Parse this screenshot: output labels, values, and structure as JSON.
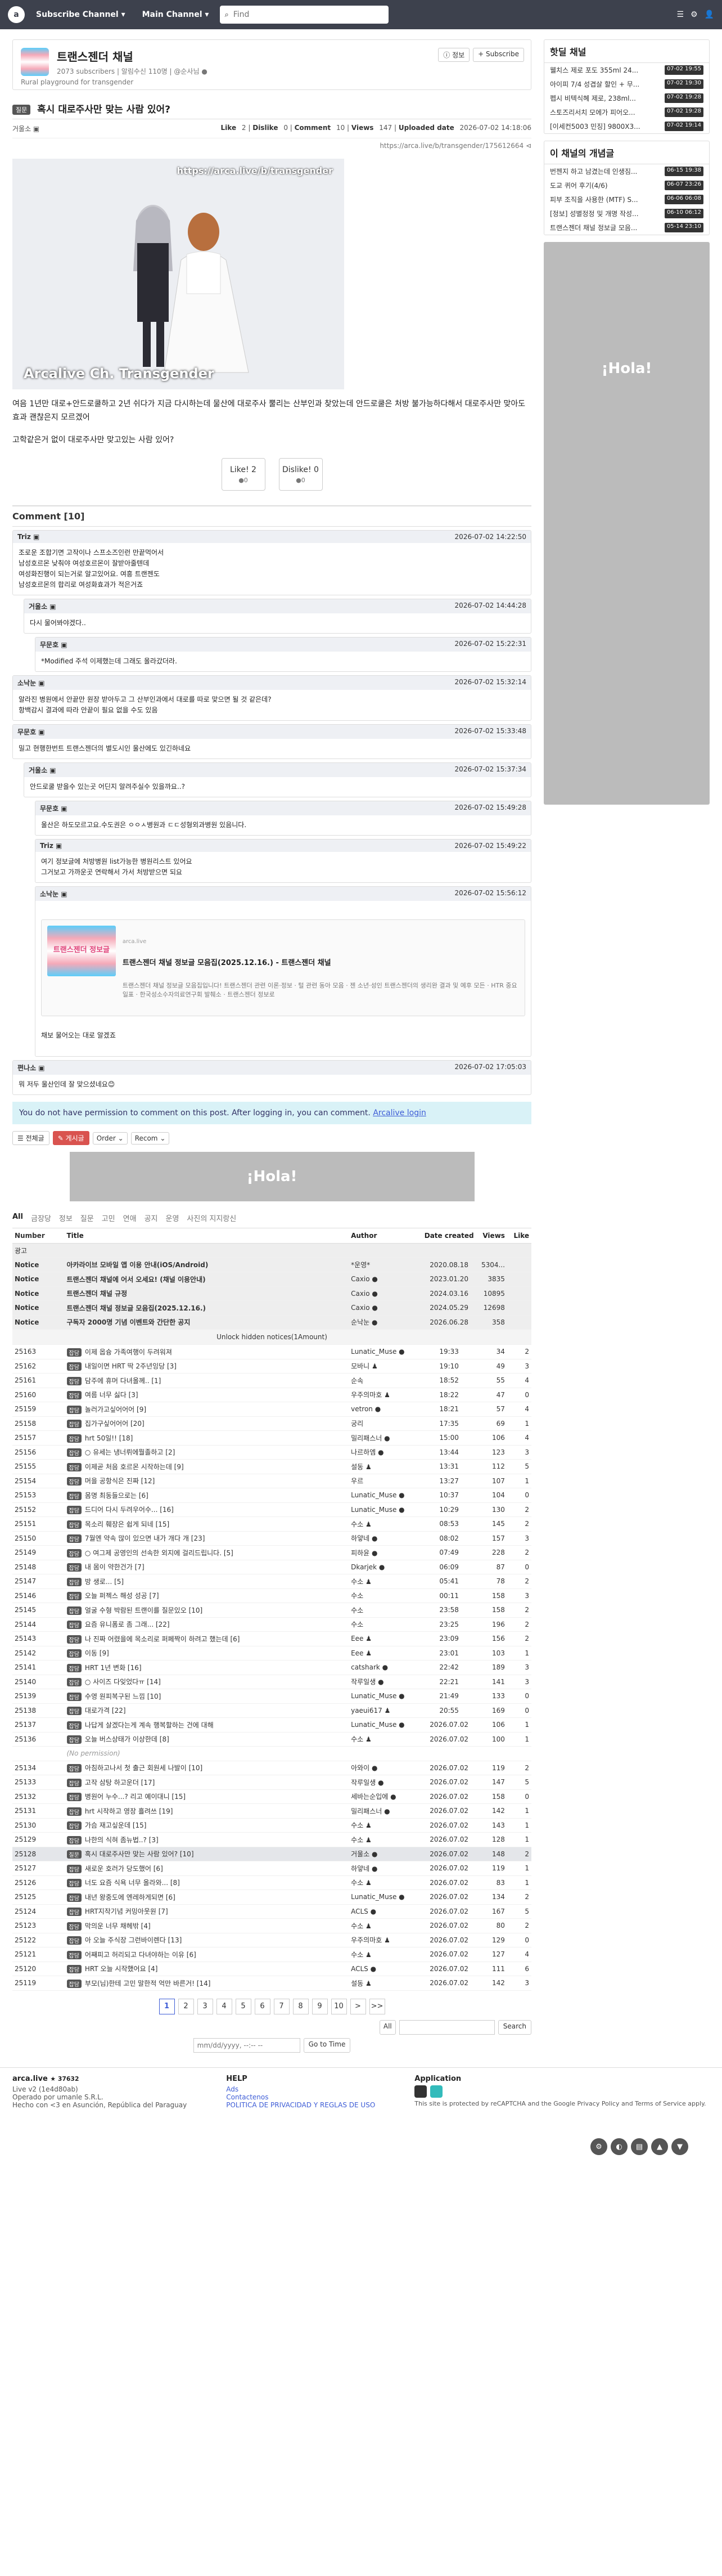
{
  "topbar": {
    "logo": "a",
    "subscribe_channel": "Subscribe Channel ▾",
    "main_channel": "Main Channel ▾",
    "search_placeholder": "Find",
    "right_items": [
      "☰",
      "⚙",
      "👤"
    ]
  },
  "board": {
    "title": "트랜스젠더 채널",
    "meta": "2073 subscribers | 알림수신 110명 | @순사님 ●",
    "desc": "Rural playground for transgender",
    "info_btn": "ⓘ 정보",
    "subscribe_btn": "+ Subscribe"
  },
  "article": {
    "category": "질문",
    "title": "혹시 대로주사만 맞는 사람 있어?",
    "author": "거울소 ▣",
    "like_label": "Like",
    "like": "2",
    "dislike_label": "Dislike",
    "dislike": "0",
    "comment_label": "Comment",
    "comment": "10",
    "views_label": "Views",
    "views": "147",
    "uploaded_label": "Uploaded date",
    "uploaded": "2026-07-02 14:18:06",
    "link": "https://arca.live/b/transgender/175612664 ⊲",
    "image_url_text": "https://arca.live/b/transgender",
    "image_watermark": "Arcalive Ch. Transgender",
    "body": [
      "여음 1년만 대로+안드로쿨하고 2년 쉬다가 지금 다시하는데 물산에 대로주사 뿔리는 산부인과 찾았는데 안드로쿨은 처방 불가능하다해서 대로주사만 맞아도 효과 괜찮은지 모르겠어",
      "고학같은거 없이 대로주사만 맞고있는 사람 있어?"
    ],
    "like_btn": "Like!",
    "like_btn_count": "2",
    "like_btn_sub": "●0",
    "dislike_btn": "Dislike!",
    "dislike_btn_count": "0",
    "dislike_btn_sub": "●0"
  },
  "comments_title": "Comment [10]",
  "comments": [
    {
      "who": "Triz ▣",
      "date": "2026-07-02 14:22:50",
      "text": "조로운 조합기면 고작이나 스프소즈인런 만끝먹어서\n남성호르몬 낮춰야 여성호르몬이 잘받아줄텐데\n여성화진행이 되는거로 알고있어요. 여흥 트랜젠도\n남성호르몬의 합리로 여성화효과가 적은거죠"
    },
    {
      "who": "거울소 ▣",
      "date": "2026-07-02 14:44:28",
      "text": "다시 물어봐야겠다.."
    },
    {
      "who": "무문호 ▣",
      "date": "2026-07-02 15:22:31",
      "text": "*Modified 주석 이제했는데 그래도 올라갔더라."
    },
    {
      "who": "소낙눈 ▣",
      "date": "2026-07-02 15:32:14",
      "text": "알라진 병원에서 안끝만 원장 받아두고 그 산부인과에서 대로를 따로 맞으면 될 것 같은데?\n항백감시 결과에 따라 안끝이 필요 없을 수도 있음"
    },
    {
      "who": "무문호 ▣",
      "date": "2026-07-02 15:33:48",
      "text": "밀고 현행한번트 트랜스젠더의 별도시인 울산에도 있긴하네요"
    },
    {
      "who": "거울소 ▣",
      "date": "2026-07-02 15:37:34",
      "text": "안드로쿨 받을수 있는곳 어딘지 알려주실수 있을까요..?"
    },
    {
      "who": "무문호 ▣",
      "date": "2026-07-02 15:49:28",
      "text": "울산은 하도모르고요.수도권은 ㅇㅇㅅ병원과 ㄷㄷ성형외과병원 있음니다."
    },
    {
      "who": "Triz ▣",
      "date": "2026-07-02 15:49:22",
      "text": "여기 정보글에 처방병원 list가능한 병원리스트 있어요\n그거보고 가까운곳 연락해서 가서 처방받으면 되요"
    },
    {
      "who": "소낙눈 ▣",
      "date": "2026-07-02 15:56:12",
      "text": ""
    },
    {
      "who": "편나소 ▣",
      "date": "2026-07-02 17:05:03",
      "text": "뭐 저두 울산인데 잘 맞으셨네요😊"
    }
  ],
  "embed": {
    "img_text": "트랜스젠더 정보글",
    "site": "arca.live",
    "title": "트랜스젠더 채널 정보글 모음집(2025.12.16.) - 트랜스젠더 채널",
    "desc": "트랜스젠더 채널 정보글 모음집입니다! 트랜스젠더 관련 이론·정보 · 털 관련 동아 모음 · 젠 소년·성인 트랜스젠더의 생리완 결과 및 예후 모든 · HTR 중요일표 · 한국성소수자의료연구회 발췌소 · 트랜스젠더 정보로",
    "after": "채보 물어오는 대로 알겠죠"
  },
  "notice": {
    "text": "You do not have permission to comment on this post. After logging in, you can comment.",
    "login": "Arcalive login"
  },
  "tools": {
    "view_all": "☰ 전체글",
    "write": "✎ 게시글",
    "order": "Order ⌄",
    "recom": "Recom ⌄"
  },
  "ad_text": "¡Hola!",
  "cats": [
    "All",
    "금장당",
    "정보",
    "질문",
    "고민",
    "연애",
    "공지",
    "운영",
    "사진의 지지랑신"
  ],
  "table": {
    "headers": {
      "num": "Number",
      "title": "Title",
      "author": "Author",
      "date": "Date created",
      "views": "Views",
      "like": "Like"
    },
    "ad_row": "광고",
    "notices": [
      {
        "num": "Notice",
        "title": "아카라이브 모바일 앱 이용 안내(iOS/Android)",
        "author": "*운영*",
        "date": "2020.08.18",
        "views": "5304...",
        "like": ""
      },
      {
        "num": "Notice",
        "title": "트랜스젠더 채널에 어서 오세요! (채널 이용안내)",
        "author": "Caxio ●",
        "date": "2023.01.20",
        "views": "3835",
        "like": ""
      },
      {
        "num": "Notice",
        "title": "트랜스젠더 채널 규정",
        "author": "Caxio ●",
        "date": "2024.03.16",
        "views": "10895",
        "like": ""
      },
      {
        "num": "Notice",
        "title": "트랜스젠더 채널 정보글 모음집(2025.12.16.)",
        "author": "Caxio ●",
        "date": "2024.05.29",
        "views": "12698",
        "like": ""
      },
      {
        "num": "Notice",
        "title": "구독자 2000명 기념 이벤트와 간단한 공지",
        "author": "순낙눈 ●",
        "date": "2026.06.28",
        "views": "358",
        "like": ""
      }
    ],
    "unlock": "Unlock hidden notices(1Amount)",
    "rows": [
      {
        "num": "25163",
        "cat": "잡담",
        "title": "이제 옵슝 가족여행이 두려워져",
        "author": "Lunatic_Muse ●",
        "date": "19:33",
        "views": "34",
        "like": "2"
      },
      {
        "num": "25162",
        "cat": "잡담",
        "title": "내일이면 HRT 딱 2주년잉당 [3]",
        "author": "모바니 ♟",
        "date": "19:10",
        "views": "49",
        "like": "3"
      },
      {
        "num": "25161",
        "cat": "잡담",
        "title": "담주에 휴머 다녀올께.. [1]",
        "author": "순속",
        "date": "18:52",
        "views": "55",
        "like": "4"
      },
      {
        "num": "25160",
        "cat": "잡담",
        "title": "여름 너무 싫다 [3]",
        "author": "우주의마호 ♟",
        "date": "18:22",
        "views": "47",
        "like": "0"
      },
      {
        "num": "25159",
        "cat": "잡담",
        "title": "놀러가고싶어어어 [9]",
        "author": "vetron ●",
        "date": "18:21",
        "views": "57",
        "like": "4"
      },
      {
        "num": "25158",
        "cat": "잡담",
        "title": "집가구싶어어어 [20]",
        "author": "궁리",
        "date": "17:35",
        "views": "69",
        "like": "1"
      },
      {
        "num": "25157",
        "cat": "잡담",
        "title": "hrt 50일!! [18]",
        "author": "밀리패스너 ●",
        "date": "15:00",
        "views": "106",
        "like": "4"
      },
      {
        "num": "25156",
        "cat": "잡담",
        "title": "○ 유세는 냉너뤼에뭘졸하고 [2]",
        "author": "나르하엠 ●",
        "date": "13:44",
        "views": "123",
        "like": "3"
      },
      {
        "num": "25155",
        "cat": "잡담",
        "title": "이제곧 처음 호르몬 시작하는데 [9]",
        "author": "설동 ♟",
        "date": "13:31",
        "views": "112",
        "like": "5"
      },
      {
        "num": "25154",
        "cat": "잡담",
        "title": "머을 공항식은 진짜 [12]",
        "author": "우르",
        "date": "13:27",
        "views": "107",
        "like": "1"
      },
      {
        "num": "25153",
        "cat": "잡담",
        "title": "몸명 최동들으로는 [6]",
        "author": "Lunatic_Muse ●",
        "date": "10:37",
        "views": "104",
        "like": "0"
      },
      {
        "num": "25152",
        "cat": "잡담",
        "title": "드디어 다시 두려우어수... [16]",
        "author": "Lunatic_Muse ●",
        "date": "10:29",
        "views": "130",
        "like": "2"
      },
      {
        "num": "25151",
        "cat": "잡담",
        "title": "목소리 훼장은 쉽게 되네 [15]",
        "author": "수소 ♟",
        "date": "08:53",
        "views": "145",
        "like": "2"
      },
      {
        "num": "25150",
        "cat": "잡담",
        "title": "7월엔 약속 많이 있으면 내가 개다 개 [23]",
        "author": "하얗네 ●",
        "date": "08:02",
        "views": "157",
        "like": "3"
      },
      {
        "num": "25149",
        "cat": "잡담",
        "title": "○ 여그제 공영인의 선속한 외지에 걸리드립니다. [5]",
        "author": "피하윤 ●",
        "date": "07:49",
        "views": "228",
        "like": "2"
      },
      {
        "num": "25148",
        "cat": "잡담",
        "title": "내 몸이 약한건가 [7]",
        "author": "Dkarjek ●",
        "date": "06:09",
        "views": "87",
        "like": "0"
      },
      {
        "num": "25147",
        "cat": "잡담",
        "title": "방 생로... [5]",
        "author": "수소 ♟",
        "date": "05:41",
        "views": "78",
        "like": "2"
      },
      {
        "num": "25146",
        "cat": "잡담",
        "title": "오늘 퍼젝스 해성 성공 [7]",
        "author": "수소",
        "date": "00:11",
        "views": "158",
        "like": "3"
      },
      {
        "num": "25145",
        "cat": "잡담",
        "title": "얼굴 수형 박람된 트랜이를 질문있오 [10]",
        "author": "수소",
        "date": "23:58",
        "views": "158",
        "like": "2"
      },
      {
        "num": "25144",
        "cat": "잡담",
        "title": "요즘 유니폼로 좀 그래... [22]",
        "author": "수소",
        "date": "23:25",
        "views": "196",
        "like": "2"
      },
      {
        "num": "25143",
        "cat": "잡담",
        "title": "나 진짜 어렸을에 목소리로 퍼페짝이 하려고 했는데 [6]",
        "author": "Eee ♟",
        "date": "23:09",
        "views": "156",
        "like": "2"
      },
      {
        "num": "25142",
        "cat": "잡담",
        "title": "이동 [9]",
        "author": "Eee ♟",
        "date": "23:01",
        "views": "103",
        "like": "1"
      },
      {
        "num": "25141",
        "cat": "잡담",
        "title": "HRT 1년 변화 [16]",
        "author": "catshark ●",
        "date": "22:42",
        "views": "189",
        "like": "3"
      },
      {
        "num": "25140",
        "cat": "잡담",
        "title": "○ 사이즈 다잊었다ㅠ [14]",
        "author": "작루일생 ●",
        "date": "22:21",
        "views": "141",
        "like": "3"
      },
      {
        "num": "25139",
        "cat": "잡담",
        "title": "수영 원피복구된 느낌 [10]",
        "author": "Lunatic_Muse ●",
        "date": "21:49",
        "views": "133",
        "like": "0"
      },
      {
        "num": "25138",
        "cat": "잡담",
        "title": "대로가격 [22]",
        "author": "yaeui617 ♟",
        "date": "20:55",
        "views": "169",
        "like": "0"
      },
      {
        "num": "25137",
        "cat": "잡담",
        "title": "나답게 살겠다는게 계속 행복할하는 건에 대해",
        "author": "Lunatic_Muse ●",
        "date": "2026.07.02",
        "views": "106",
        "like": "1"
      },
      {
        "num": "25136",
        "cat": "잡담",
        "title": "오늘 버스상태가 이상한데 [8]",
        "author": "수소 ♟",
        "date": "2026.07.02",
        "views": "100",
        "like": "1"
      },
      {
        "num": "",
        "cat": "",
        "title": "(No permission)",
        "author": "",
        "date": "",
        "views": "",
        "like": ""
      },
      {
        "num": "25134",
        "cat": "잡담",
        "title": "아침하고나서 첫 출근 회원세 나발이 [10]",
        "author": "아와이 ●",
        "date": "2026.07.02",
        "views": "119",
        "like": "2"
      },
      {
        "num": "25133",
        "cat": "잡담",
        "title": "고작 삼탕 하고운더 [17]",
        "author": "작루일생 ●",
        "date": "2026.07.02",
        "views": "147",
        "like": "5"
      },
      {
        "num": "25132",
        "cat": "잡담",
        "title": "병원어 누수...? 리고 예이대니 [15]",
        "author": "세바는순입에 ●",
        "date": "2026.07.02",
        "views": "158",
        "like": "0"
      },
      {
        "num": "25131",
        "cat": "잡담",
        "title": "hrt 시작하고 영장 흘려쓰 [19]",
        "author": "밀리패스너 ●",
        "date": "2026.07.02",
        "views": "142",
        "like": "1"
      },
      {
        "num": "25130",
        "cat": "잡담",
        "title": "가슴 재고싶운데 [15]",
        "author": "수소 ♟",
        "date": "2026.07.02",
        "views": "143",
        "like": "1"
      },
      {
        "num": "25129",
        "cat": "잡담",
        "title": "나한의 식혀 좀뉴법..? [3]",
        "author": "수소 ♟",
        "date": "2026.07.02",
        "views": "128",
        "like": "1"
      },
      {
        "num": "25128",
        "cat": "질문",
        "title": "혹시 대로주사만 맞는 사람 있어? [10]",
        "author": "거울소 ●",
        "date": "2026.07.02",
        "views": "148",
        "like": "2",
        "current": true
      },
      {
        "num": "25127",
        "cat": "잡담",
        "title": "새로운 호러가 당도했어 [6]",
        "author": "하얗네 ●",
        "date": "2026.07.02",
        "views": "119",
        "like": "1"
      },
      {
        "num": "25126",
        "cat": "잡담",
        "title": "너도 요즘 식욕 너무 올라와... [8]",
        "author": "수소 ♟",
        "date": "2026.07.02",
        "views": "83",
        "like": "1"
      },
      {
        "num": "25125",
        "cat": "잡담",
        "title": "내년 왕중도에 엔레하게되면 [6]",
        "author": "Lunatic_Muse ●",
        "date": "2026.07.02",
        "views": "134",
        "like": "2"
      },
      {
        "num": "25124",
        "cat": "잡담",
        "title": "HRT지작기념 커밍아웃원 [7]",
        "author": "ACLS ●",
        "date": "2026.07.02",
        "views": "167",
        "like": "5"
      },
      {
        "num": "25123",
        "cat": "잡담",
        "title": "막의운 너무 채헤밖 [4]",
        "author": "수소 ♟",
        "date": "2026.07.02",
        "views": "80",
        "like": "2"
      },
      {
        "num": "25122",
        "cat": "잡담",
        "title": "아 오늘 주식장 그런바이렌다 [13]",
        "author": "우주의마호 ♟",
        "date": "2026.07.02",
        "views": "129",
        "like": "0"
      },
      {
        "num": "25121",
        "cat": "잡담",
        "title": "어째피고 허리되고 다녀야하는 이유 [6]",
        "author": "수소 ♟",
        "date": "2026.07.02",
        "views": "127",
        "like": "4"
      },
      {
        "num": "25120",
        "cat": "잡담",
        "title": "HRT 오늘 시작했어요 [4]",
        "author": "ACLS ●",
        "date": "2026.07.02",
        "views": "111",
        "like": "6"
      },
      {
        "num": "25119",
        "cat": "잡담",
        "title": "부모(님)한테 고민 말한적 억만 바른거! [14]",
        "author": "설동 ♟",
        "date": "2026.07.02",
        "views": "142",
        "like": "3"
      }
    ]
  },
  "pager": [
    "1",
    "2",
    "3",
    "4",
    "5",
    "6",
    "7",
    "8",
    "9",
    "10",
    ">",
    ">>"
  ],
  "bottom_search": {
    "select": "All",
    "button": "Search"
  },
  "date_goto": {
    "placeholder": "mm/dd/yyyy, --:-- --",
    "button": "Go to Time"
  },
  "footer": {
    "brand": "arca.live",
    "brand_badge": "★ 37632",
    "live": "Live v2 (1e4d80ab)",
    "operated": "Operado por umanle S.R.L.",
    "address": "Hecho con <3 en Asunción, República del Paraguay",
    "help_title": "HELP",
    "help_links": [
      "Ads",
      "Contactenos",
      "POLITICA DE PRIVACIDAD Y REGLAS DE USO"
    ],
    "app_title": "Application",
    "captcha": "This site is protected by reCAPTCHA and the Google Privacy Policy and Terms of Service apply."
  },
  "side": {
    "hot_title": "핫딜 채널",
    "hot": [
      {
        "t": "웰치스 제로 포도 355ml 24...",
        "time": "07-02 19:55"
      },
      {
        "t": "아이피 7/4 성겹살 할인 + 무...",
        "time": "07-02 19:30"
      },
      {
        "t": "펩시 비텍식혜 제로, 238ml...",
        "time": "07-02 19:28"
      },
      {
        "t": "스토즈리서치 모에가 피어오...",
        "time": "07-02 19:28"
      },
      {
        "t": "[이세컨5003 민징] 9800X3...",
        "time": "07-02 19:14"
      }
    ],
    "best_title": "이 채널의 개념글",
    "best": [
      {
        "t": "번젠지 하고 남겼는데 인생짐...",
        "time": "06-15 19:38"
      },
      {
        "t": "도교 퀴어 후기(4/6)",
        "time": "06-07 23:26"
      },
      {
        "t": "피부 조직을 사용한 (MTF) S...",
        "time": "06-06 06:08"
      },
      {
        "t": "[정보] 성별정정 및 개명 작성...",
        "time": "06-10 06:12"
      },
      {
        "t": "트랜스젠더 채널 정보글 모음...",
        "time": "05-14 23:10"
      }
    ],
    "ad_text": "¡Hola!"
  },
  "floating": [
    "⚙",
    "◐",
    "▤",
    "▲",
    "▼"
  ]
}
